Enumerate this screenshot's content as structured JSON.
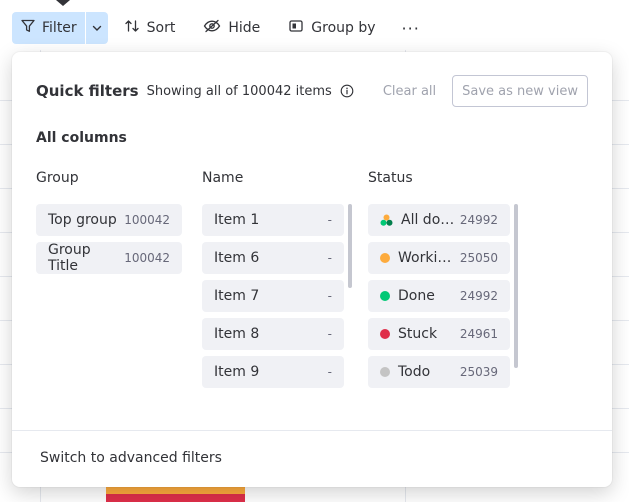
{
  "toolbar": {
    "filter_label": "Filter",
    "sort_label": "Sort",
    "hide_label": "Hide",
    "group_by_label": "Group by",
    "more_label": "···"
  },
  "quick_filters": {
    "title": "Quick filters",
    "summary": "Showing all of 100042 items",
    "clear_all": "Clear all",
    "save_view": "Save as new view",
    "section_title": "All columns",
    "advanced_link": "Switch to advanced filters"
  },
  "columns": {
    "group": {
      "title": "Group",
      "items": [
        {
          "label": "Top group",
          "count": "100042"
        },
        {
          "label": "Group Title",
          "count": "100042"
        }
      ]
    },
    "name": {
      "title": "Name",
      "items": [
        {
          "label": "Item 1",
          "count": "-"
        },
        {
          "label": "Item 6",
          "count": "-"
        },
        {
          "label": "Item 7",
          "count": "-"
        },
        {
          "label": "Item 8",
          "count": "-"
        },
        {
          "label": "Item 9",
          "count": "-"
        }
      ]
    },
    "status": {
      "title": "Status",
      "items": [
        {
          "label": "All done...",
          "count": "24992",
          "icon": "multi-color-dots-icon"
        },
        {
          "label": "Workin...",
          "count": "25050",
          "color": "#fdab3d"
        },
        {
          "label": "Done",
          "count": "24992",
          "color": "#00c875"
        },
        {
          "label": "Stuck",
          "count": "24961",
          "color": "#df2f4a"
        },
        {
          "label": "Todo",
          "count": "25039",
          "color": "#c4c4c4"
        }
      ]
    }
  },
  "colors": {
    "filter_active_bg": "#cce5ff",
    "status_working": "#fdab3d",
    "status_done": "#00c875",
    "status_stuck": "#df2f4a",
    "status_todo": "#c4c4c4"
  }
}
